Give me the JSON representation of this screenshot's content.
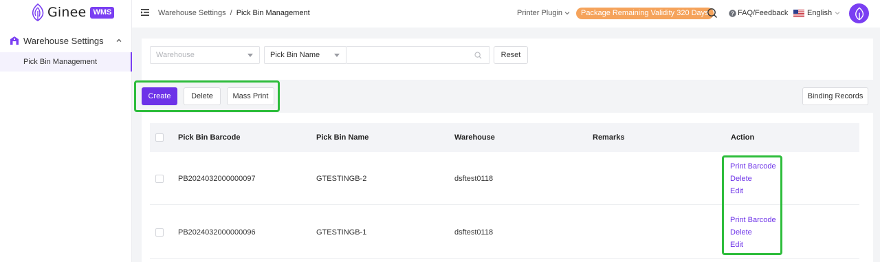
{
  "app": {
    "logo_text": "Ginee",
    "badge": "WMS"
  },
  "sidebar": {
    "group": {
      "label": "Warehouse Settings",
      "icon": "warehouse-icon",
      "expanded": true
    },
    "items": [
      {
        "label": "Pick Bin Management",
        "active": true
      }
    ]
  },
  "header": {
    "breadcrumb": [
      "Warehouse Settings",
      "/",
      "Pick Bin Management"
    ],
    "printer_plugin": "Printer Plugin",
    "validity": "Package Remaining Validity 320 Days",
    "faq": "FAQ/Feedback",
    "language": "English"
  },
  "filters": {
    "warehouse_placeholder": "Warehouse",
    "field_select": "Pick Bin Name",
    "search_value": "",
    "reset": "Reset"
  },
  "toolbar": {
    "create": "Create",
    "delete": "Delete",
    "mass_print": "Mass Print",
    "binding_records": "Binding Records"
  },
  "table": {
    "columns": [
      "Pick Bin Barcode",
      "Pick Bin Name",
      "Warehouse",
      "Remarks",
      "Action"
    ],
    "rows": [
      {
        "barcode": "PB2024032000000097",
        "name": "GTESTINGB-2",
        "warehouse": "dsftest0118",
        "remarks": "",
        "actions": [
          "Print Barcode",
          "Delete",
          "Edit"
        ]
      },
      {
        "barcode": "PB2024032000000096",
        "name": "GTESTINGB-1",
        "warehouse": "dsftest0118",
        "remarks": "",
        "actions": [
          "Print Barcode",
          "Delete",
          "Edit"
        ]
      }
    ]
  },
  "colors": {
    "brand": "#6d32e8",
    "badge_orange": "#f5a35b",
    "annotation_green": "#2ebd3c"
  }
}
